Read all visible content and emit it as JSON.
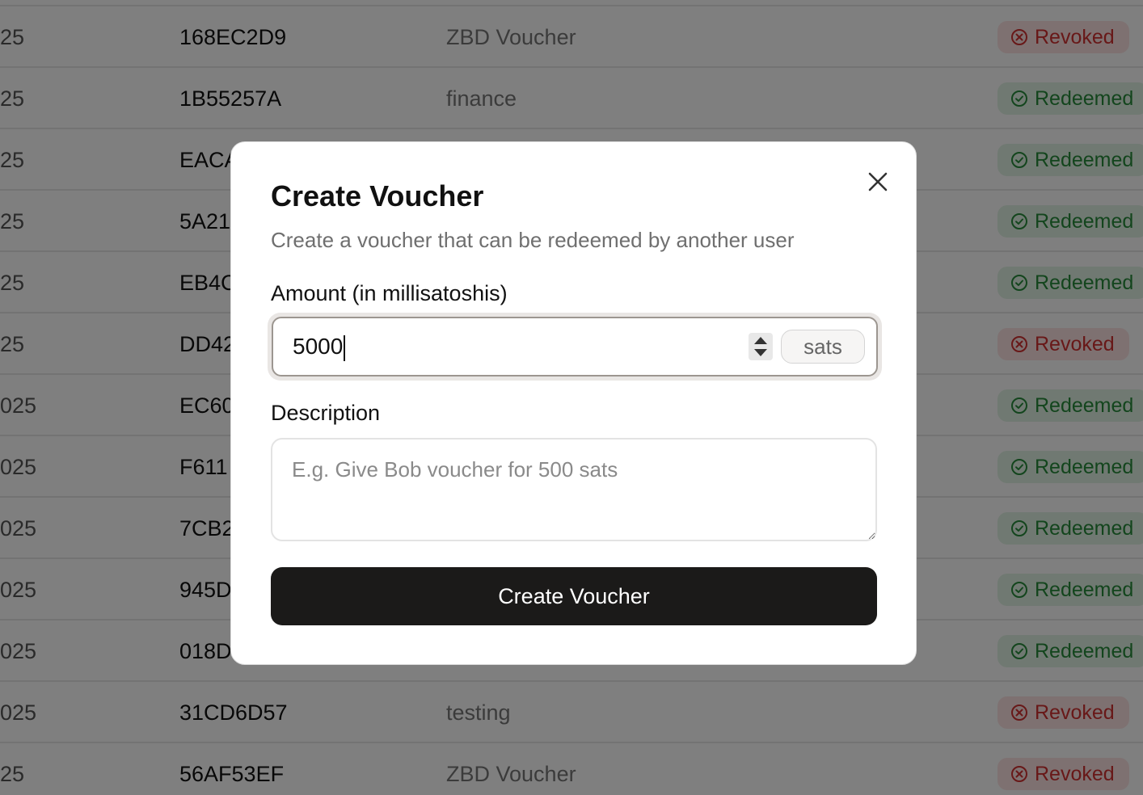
{
  "table": {
    "rows": [
      {
        "date": "25",
        "code": "168EC2D9",
        "description": "ZBD Voucher",
        "status": "Revoked"
      },
      {
        "date": "25",
        "code": "1B55257A",
        "description": "finance",
        "status": "Redeemed"
      },
      {
        "date": "25",
        "code": "EACA",
        "description": "",
        "status": "Redeemed"
      },
      {
        "date": "25",
        "code": "5A21",
        "description": "",
        "status": "Redeemed"
      },
      {
        "date": "25",
        "code": "EB4C",
        "description": "",
        "status": "Redeemed"
      },
      {
        "date": "25",
        "code": "DD42",
        "description": "",
        "status": "Revoked"
      },
      {
        "date": "025",
        "code": "EC60",
        "description": "",
        "status": "Redeemed"
      },
      {
        "date": "025",
        "code": "F611",
        "description": "",
        "status": "Redeemed"
      },
      {
        "date": "025",
        "code": "7CB2",
        "description": "",
        "status": "Redeemed"
      },
      {
        "date": "025",
        "code": "945D",
        "description": "",
        "status": "Redeemed"
      },
      {
        "date": "025",
        "code": "018D",
        "description": "",
        "status": "Redeemed"
      },
      {
        "date": "025",
        "code": "31CD6D57",
        "description": "testing",
        "status": "Revoked"
      },
      {
        "date": "25",
        "code": "56AF53EF",
        "description": "ZBD Voucher",
        "status": "Revoked"
      }
    ]
  },
  "modal": {
    "title": "Create Voucher",
    "subtitle": "Create a voucher that can be redeemed by another user",
    "amount_label": "Amount (in millisatoshis)",
    "amount_value": "5000",
    "amount_unit": "sats",
    "description_label": "Description",
    "description_placeholder": "E.g. Give Bob voucher for 500 sats",
    "submit_label": "Create Voucher"
  },
  "colors": {
    "revoked_bg": "#fde2e2",
    "revoked_text": "#d03030",
    "redeemed_bg": "#e1f3e4",
    "redeemed_text": "#268a3a",
    "button_bg": "#1b1a19"
  },
  "icons": {
    "revoked": "x-circle-icon",
    "redeemed": "check-circle-icon",
    "close": "close-icon"
  }
}
